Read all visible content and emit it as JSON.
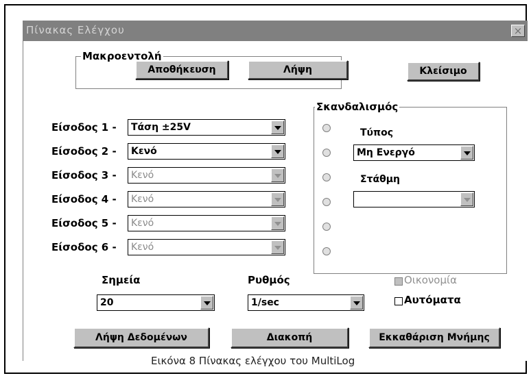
{
  "window": {
    "title": "Πίνακας Ελέγχου",
    "close_glyph": "×"
  },
  "macro": {
    "group_label": "Μακροεντολή",
    "save_label": "Αποθήκευση",
    "load_label": "Λήψη"
  },
  "close_label": "Κλείσιμο",
  "inputs": [
    {
      "label": "Είσοδος 1 -",
      "value": "Τάση ±25V",
      "enabled": true
    },
    {
      "label": "Είσοδος 2 -",
      "value": "Κενό",
      "enabled": true
    },
    {
      "label": "Είσοδος 3 -",
      "value": "Κενό",
      "enabled": false
    },
    {
      "label": "Είσοδος 4 -",
      "value": "Κενό",
      "enabled": false
    },
    {
      "label": "Είσοδος 5 -",
      "value": "Κενό",
      "enabled": false
    },
    {
      "label": "Είσοδος 6 -",
      "value": "Κενό",
      "enabled": false
    }
  ],
  "trigger": {
    "group_label": "Σκανδαλισμός",
    "type_label": "Τύπος",
    "type_value": "Μη Ενεργό",
    "level_label": "Στάθμη",
    "level_value": ""
  },
  "points": {
    "label": "Σημεία",
    "value": "20"
  },
  "rate": {
    "label": "Ρυθμός",
    "value": "1/sec"
  },
  "options": {
    "economy_label": "Οικονομία",
    "economy_enabled": false,
    "auto_label": "Αυτόματα",
    "auto_checked": false
  },
  "actions": {
    "acquire_label": "Λήψη Δεδομένων",
    "stop_label": "Διακοπή",
    "clear_label": "Εκκαθάριση Μνήμης"
  },
  "caption": "Εικόνα 8 Πίνακας ελέγχου του MultiLog"
}
